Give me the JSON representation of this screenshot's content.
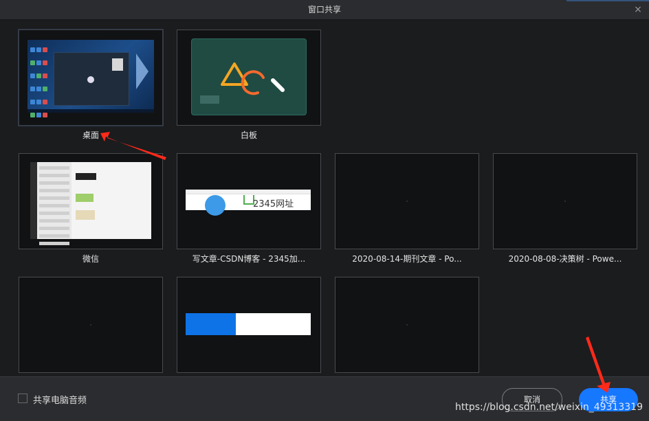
{
  "window": {
    "title": "窗口共享",
    "close_glyph": "×"
  },
  "tiles": [
    {
      "label": "桌面",
      "kind": "desktop"
    },
    {
      "label": "白板",
      "kind": "whiteboard"
    },
    {
      "label": "微信",
      "kind": "wechat"
    },
    {
      "label": "写文章-CSDN博客 - 2345加...",
      "kind": "browser",
      "thumb_text": "2345网址"
    },
    {
      "label": "2020-08-14-期刊文章 - Po...",
      "kind": "blank"
    },
    {
      "label": "2020-08-08-决策树 - Powe...",
      "kind": "blank"
    },
    {
      "label": "",
      "kind": "blank"
    },
    {
      "label": "",
      "kind": "progress",
      "progress_fraction": 0.4
    },
    {
      "label": "",
      "kind": "blank"
    }
  ],
  "footer": {
    "share_audio_label": "共享电脑音频",
    "cancel_label": "取消",
    "share_label": "共享",
    "watermark": "https://blog.csdn.net/weixin_49313319"
  },
  "colors": {
    "accent": "#1677ff",
    "annotation_arrow": "#ff2a1a"
  }
}
